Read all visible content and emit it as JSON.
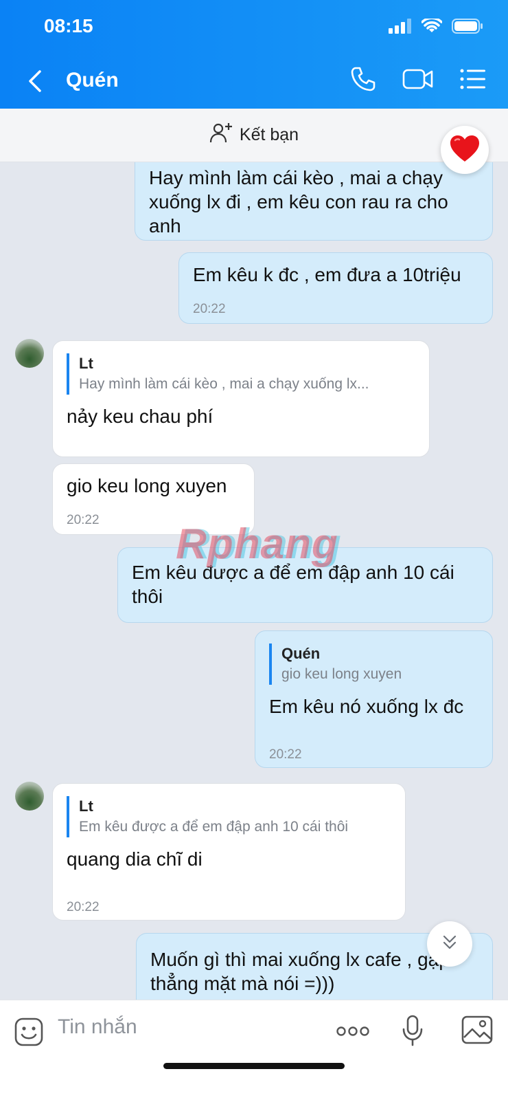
{
  "status": {
    "time": "08:15"
  },
  "header": {
    "title": "Quén"
  },
  "add_friend": {
    "label": "Kết bạn"
  },
  "messages": [
    {
      "text": "Hay mình làm cái kèo , mai a chạy xuống lx đi , em kêu con rau ra cho anh"
    },
    {
      "text": "Em kêu k đc , em đưa a 10triệu",
      "time": "20:22"
    },
    {
      "quote_name": "Lt",
      "quote_text": "Hay mình làm cái kèo , mai a chạy xuống lx...",
      "text": "nảy keu chau phí"
    },
    {
      "text": "gio keu long xuyen",
      "time": "20:22"
    },
    {
      "text": "Em kêu được a để em đập anh 10 cái thôi"
    },
    {
      "quote_name": "Quén",
      "quote_text": "gio keu long xuyen",
      "text": "Em kêu nó xuống lx đc",
      "time": "20:22"
    },
    {
      "quote_name": "Lt",
      "quote_text": "Em kêu được a để em đập anh 10 cái thôi",
      "text": "quang dia chĩ di",
      "time": "20:22"
    },
    {
      "text": "Muốn gì thì mai xuống lx cafe , gặp thẳng mặt mà nói =)))"
    }
  ],
  "watermark": "Rphang",
  "composer": {
    "placeholder": "Tin nhắn"
  },
  "colors": {
    "header": "#0a82f5",
    "outgoing_bubble": "#d4ecfb",
    "incoming_bubble": "#ffffff",
    "quote_bar": "#1a85f0"
  }
}
